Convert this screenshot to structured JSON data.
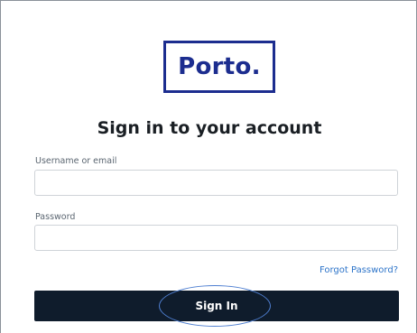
{
  "logo": {
    "text": "Porto."
  },
  "heading": "Sign in to your account",
  "form": {
    "username": {
      "label": "Username or email",
      "value": "",
      "placeholder": ""
    },
    "password": {
      "label": "Password",
      "value": "",
      "placeholder": ""
    },
    "forgot_password": "Forgot Password?",
    "submit_label": "Sign In"
  },
  "colors": {
    "brand": "#1c2d8f",
    "button": "#0f1c2c",
    "link": "#2d74c9",
    "annotation": "#4f7fd1"
  }
}
